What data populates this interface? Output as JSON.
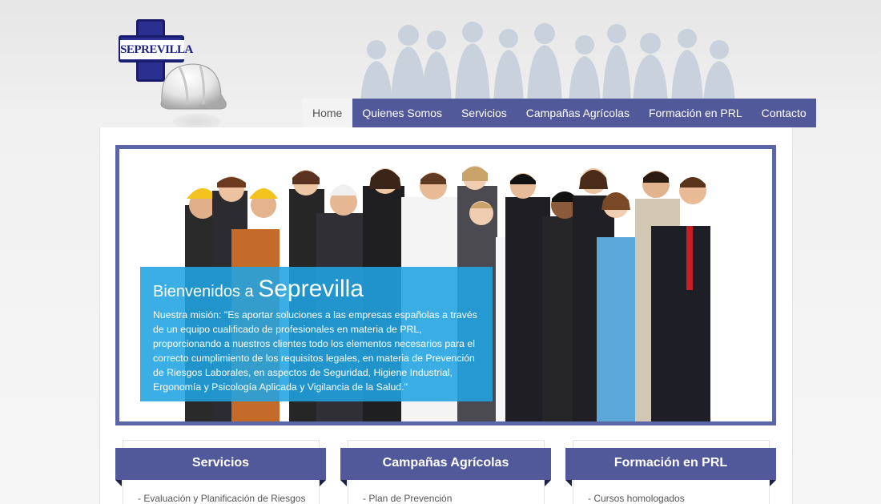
{
  "brand": {
    "logo_text": "SEPREVILLA"
  },
  "nav": {
    "items": [
      {
        "label": "Home",
        "active": true
      },
      {
        "label": "Quienes Somos",
        "active": false
      },
      {
        "label": "Servicios",
        "active": false
      },
      {
        "label": "Campañas Agrícolas",
        "active": false
      },
      {
        "label": "Formación en PRL",
        "active": false
      },
      {
        "label": "Contacto",
        "active": false
      }
    ]
  },
  "banner": {
    "title_prefix": "Bienvenidos a",
    "title_name": "Seprevilla",
    "text": "Nuestra misión: \"Es aportar soluciones a las empresas españolas a través de un equipo cualificado de profesionales en materia de PRL, proporcionando a nuestros clientes todo los elementos necesarios para el correcto cumplimiento de los requisitos legales, en materia de Prevención de Riesgos Laborales, en aspectos de Seguridad, Higiene Industrial, Ergonomía y Psicología Aplicada y Vigilancia de la Salud.\""
  },
  "boxes": [
    {
      "title": "Servicios",
      "first_item": "- Evaluación y Planificación de Riesgos"
    },
    {
      "title": "Campañas Agrícolas",
      "first_item": "- Plan de Prevención"
    },
    {
      "title": "Formación en PRL",
      "first_item": "- Cursos homologados"
    }
  ],
  "colors": {
    "nav_bg": "#52599b",
    "banner_border": "#5c65a6",
    "caption_bg": "#20a4e1",
    "page_bg": "#f1f1f1"
  },
  "icons": [
    "logo-cross-icon",
    "hard-hat-icon",
    "crowd-silhouette-image",
    "workers-photo"
  ]
}
